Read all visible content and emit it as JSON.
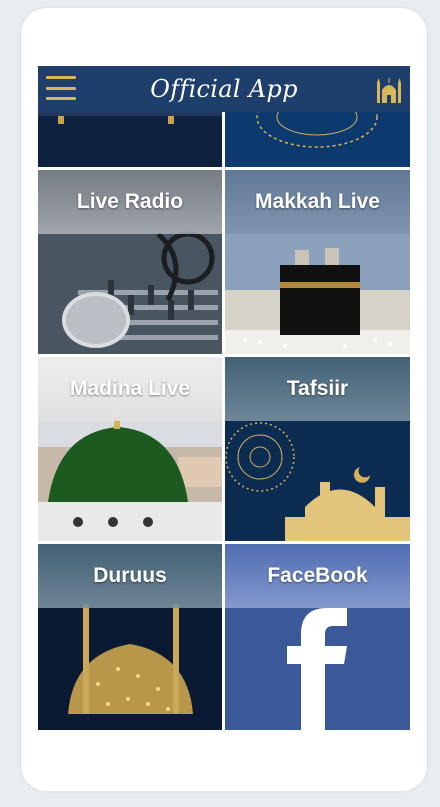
{
  "appbar": {
    "title": "Official App",
    "menu_icon": "hamburger-menu-icon",
    "right_icon": "mosque-icon",
    "accent_color": "#d8b75a",
    "bar_color": "#1e3f6b"
  },
  "tiles": [
    {
      "label": "Live Radio"
    },
    {
      "label": "Makkah Live"
    },
    {
      "label": "Madina Live"
    },
    {
      "label": "Tafsiir"
    },
    {
      "label": "Duruus"
    },
    {
      "label": "FaceBook"
    }
  ]
}
